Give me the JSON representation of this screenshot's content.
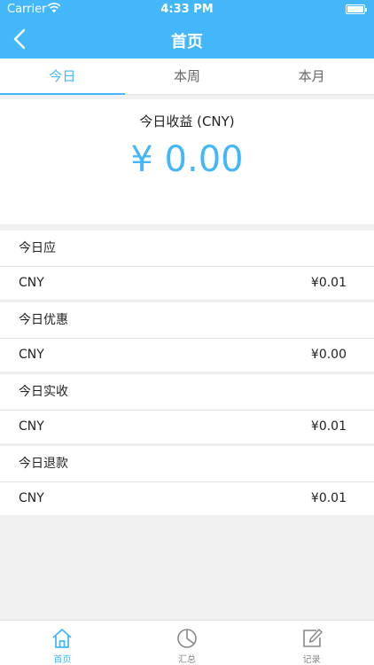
{
  "status": {
    "carrier": "Carrier",
    "time": "4:33 PM"
  },
  "nav": {
    "title": "首页"
  },
  "tabs": [
    {
      "label": "今日",
      "active": true
    },
    {
      "label": "本周",
      "active": false
    },
    {
      "label": "本月",
      "active": false
    }
  ],
  "summary": {
    "label": "今日收益 (CNY)",
    "amount": "¥ 0.00"
  },
  "sections": [
    {
      "title": "今日应",
      "currency": "CNY",
      "value": "¥0.01"
    },
    {
      "title": "今日优惠",
      "currency": "CNY",
      "value": "¥0.00"
    },
    {
      "title": "今日实收",
      "currency": "CNY",
      "value": "¥0.01"
    },
    {
      "title": "今日退款",
      "currency": "CNY",
      "value": "¥0.01"
    }
  ],
  "tabbar": [
    {
      "label": "首页",
      "icon": "home-icon",
      "active": true
    },
    {
      "label": "汇总",
      "icon": "pie-chart-icon",
      "active": false
    },
    {
      "label": "记录",
      "icon": "edit-note-icon",
      "active": false
    }
  ],
  "colors": {
    "accent": "#44b7fa",
    "background": "#f0f0f0"
  }
}
